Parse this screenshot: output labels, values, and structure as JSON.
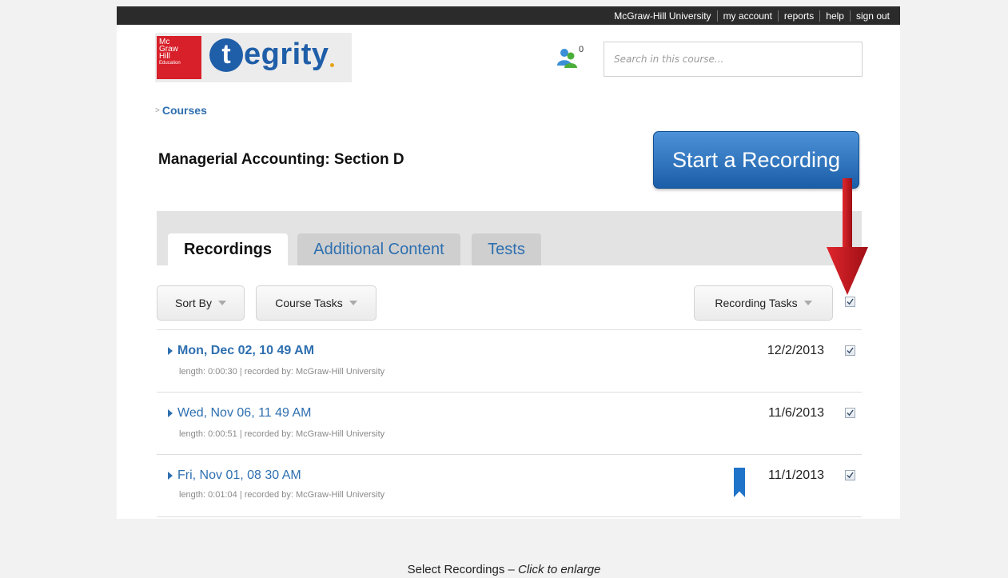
{
  "topnav": {
    "items": [
      "McGraw-Hill University",
      "my account",
      "reports",
      "help",
      "sign out"
    ]
  },
  "logo": {
    "publisher_lines": [
      "Mc",
      "Graw",
      "Hill",
      "Education"
    ],
    "brand_initial": "t",
    "brand_rest": "egrity"
  },
  "header": {
    "users_count": "0",
    "search_placeholder": "Search in this course..."
  },
  "breadcrumb": {
    "separator": ">",
    "label": "Courses"
  },
  "course": {
    "title": "Managerial Accounting: Section D"
  },
  "start_button": {
    "label": "Start a Recording"
  },
  "tabs": [
    {
      "label": "Recordings",
      "active": true
    },
    {
      "label": "Additional Content",
      "active": false
    },
    {
      "label": "Tests",
      "active": false
    }
  ],
  "toolbar": {
    "sort_by": "Sort By",
    "course_tasks": "Course Tasks",
    "recording_tasks": "Recording Tasks",
    "select_all_checked": true
  },
  "recordings": [
    {
      "title": "Mon, Dec 02, 10 49 AM",
      "meta": "length: 0:00:30 | recorded by: McGraw-Hill University",
      "date": "12/2/2013",
      "checked": true,
      "bookmarked": false,
      "bold": true
    },
    {
      "title": "Wed, Nov 06, 11 49 AM",
      "meta": "length: 0:00:51 | recorded by: McGraw-Hill University",
      "date": "11/6/2013",
      "checked": true,
      "bookmarked": false,
      "bold": false
    },
    {
      "title": "Fri, Nov 01, 08 30 AM",
      "meta": "length: 0:01:04 | recorded by: McGraw-Hill University",
      "date": "11/1/2013",
      "checked": true,
      "bookmarked": true,
      "bold": false
    }
  ],
  "caption": {
    "text": "Select Recordings – ",
    "italic": "Click to enlarge"
  },
  "colors": {
    "accent": "#2e6fb0",
    "button": "#1b5ea8",
    "arrow": "#c8161d",
    "topbar": "#2b2b2b"
  }
}
